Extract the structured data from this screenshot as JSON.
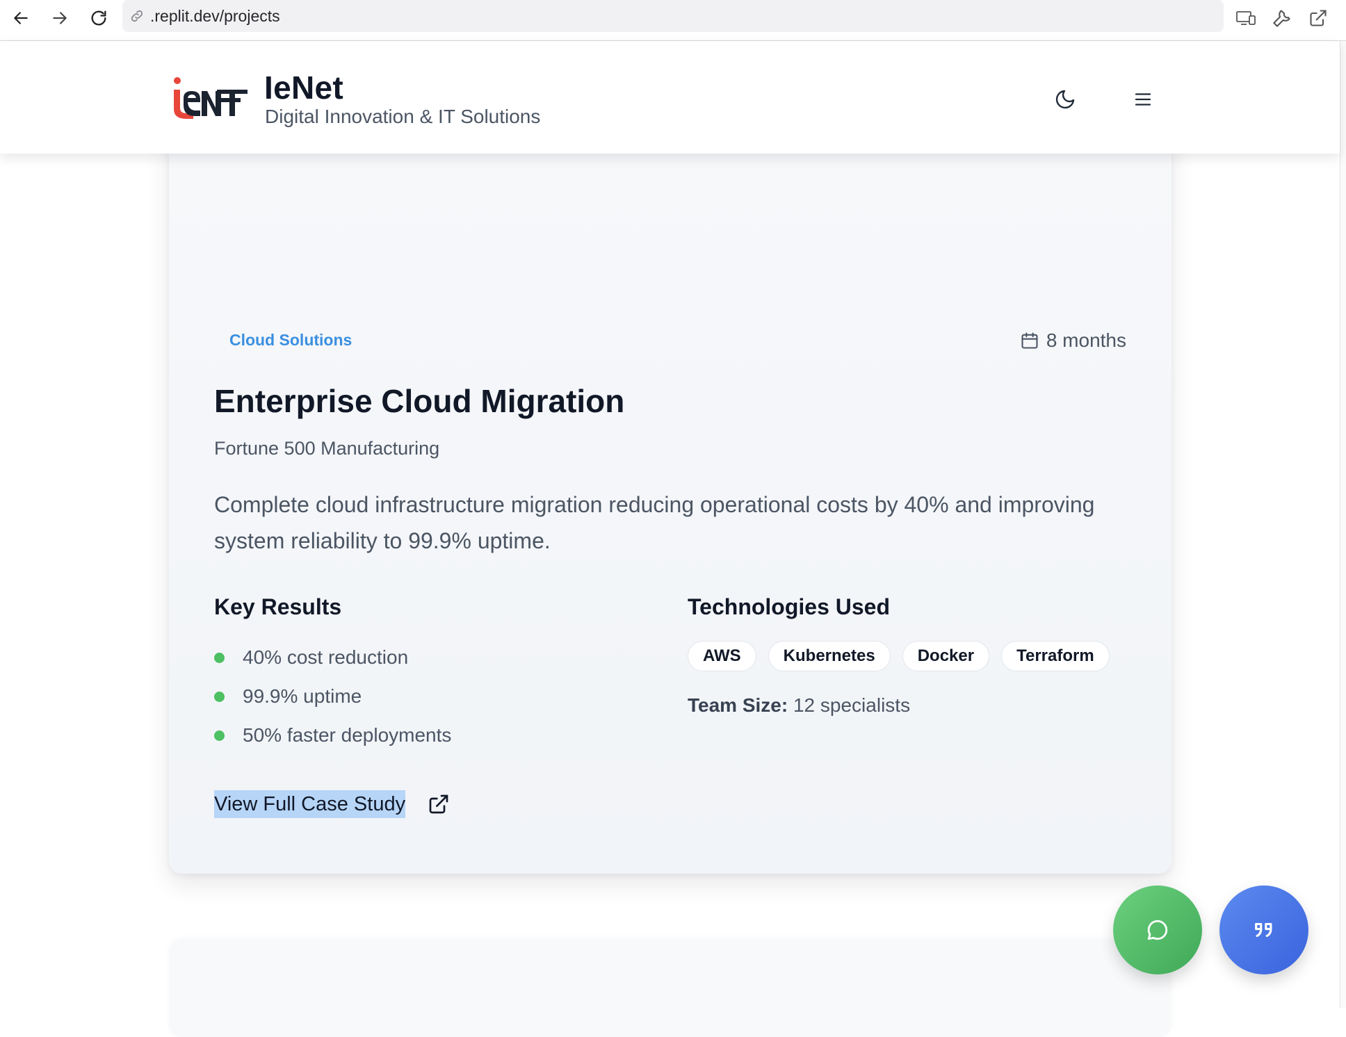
{
  "browser": {
    "url": ".replit.dev/projects",
    "icons": [
      "back-arrow-icon",
      "forward-arrow-icon",
      "reload-icon",
      "link-icon",
      "devices-icon",
      "wrench-icon",
      "open-external-icon"
    ]
  },
  "header": {
    "brand_name": "IeNet",
    "tagline": "Digital Innovation & IT Solutions",
    "icons": [
      "moon-icon",
      "hamburger-menu-icon"
    ]
  },
  "project": {
    "category": "Cloud Solutions",
    "duration": "8 months",
    "title": "Enterprise Cloud Migration",
    "client": "Fortune 500 Manufacturing",
    "description": "Complete cloud infrastructure migration reducing operational costs by 40% and improving system reliability to 99.9% uptime.",
    "key_results_heading": "Key Results",
    "key_results": [
      "40% cost reduction",
      "99.9% uptime",
      "50% faster deployments"
    ],
    "tech_heading": "Technologies Used",
    "technologies": [
      "AWS",
      "Kubernetes",
      "Docker",
      "Terraform"
    ],
    "team_label": "Team Size:",
    "team_value": "12 specialists",
    "case_study_link": "View Full Case Study"
  },
  "colors": {
    "accent_blue": "#3b8fe0",
    "result_dot": "#4cc062",
    "chat_fab": "#4cbb63",
    "quote_fab": "#4a75e6",
    "selection_highlight": "#b6d5f7"
  }
}
